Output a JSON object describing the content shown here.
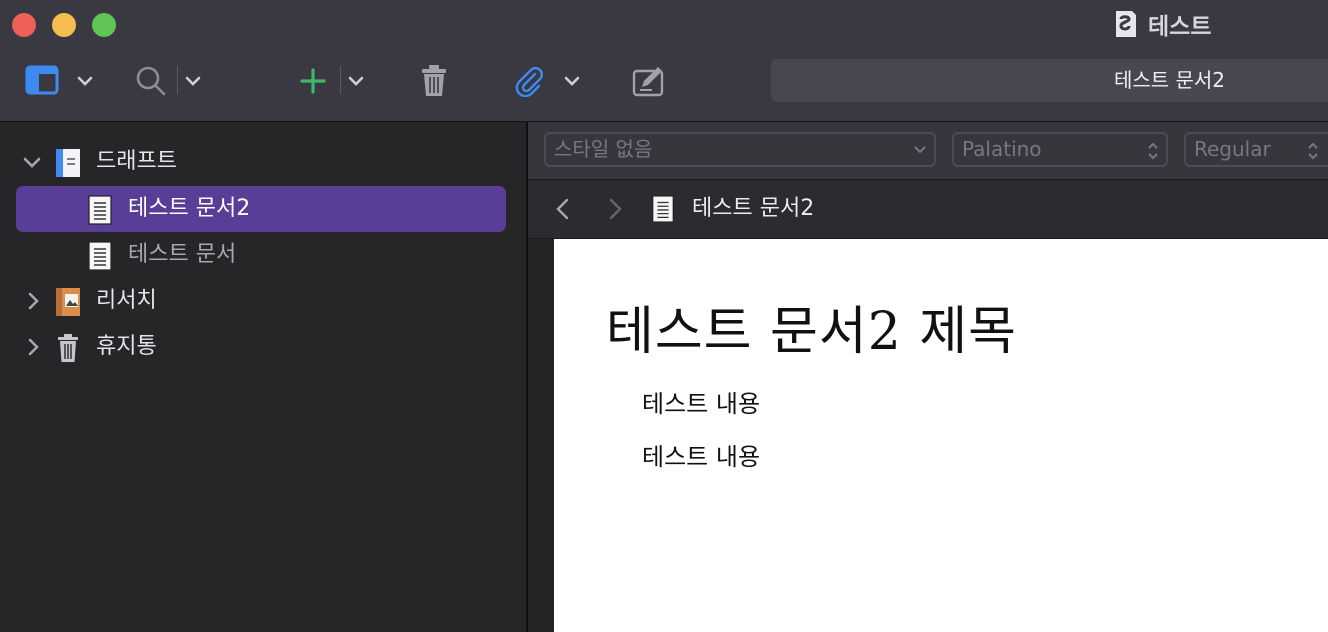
{
  "window": {
    "title": "테스트",
    "current_document": "테스트 문서2"
  },
  "toolbar": {
    "icons": [
      "sidebar-icon",
      "search-icon",
      "add-icon",
      "trash-icon",
      "attachment-icon",
      "compose-icon"
    ],
    "accent_colors": {
      "sidebar": "#3d8bf2",
      "add": "#3fb867",
      "attachment": "#3d8bf2"
    }
  },
  "binder": {
    "items": [
      {
        "label": "드래프트",
        "icon": "draft-folder-icon",
        "expanded": true
      },
      {
        "label": "테스트 문서2",
        "icon": "document-icon",
        "selected": true
      },
      {
        "label": "테스트 문서",
        "icon": "document-icon"
      },
      {
        "label": "리서치",
        "icon": "research-folder-icon",
        "expanded": false
      },
      {
        "label": "휴지통",
        "icon": "trash-icon",
        "expanded": false
      }
    ],
    "selection_color": "#5a3d96"
  },
  "format_bar": {
    "style": "스타일 없음",
    "font": "Palatino",
    "weight": "Regular"
  },
  "editor": {
    "header_title": "테스트 문서2",
    "heading": "테스트 문서2 제목",
    "paragraphs": [
      "테스트 내용",
      "테스트 내용"
    ]
  }
}
